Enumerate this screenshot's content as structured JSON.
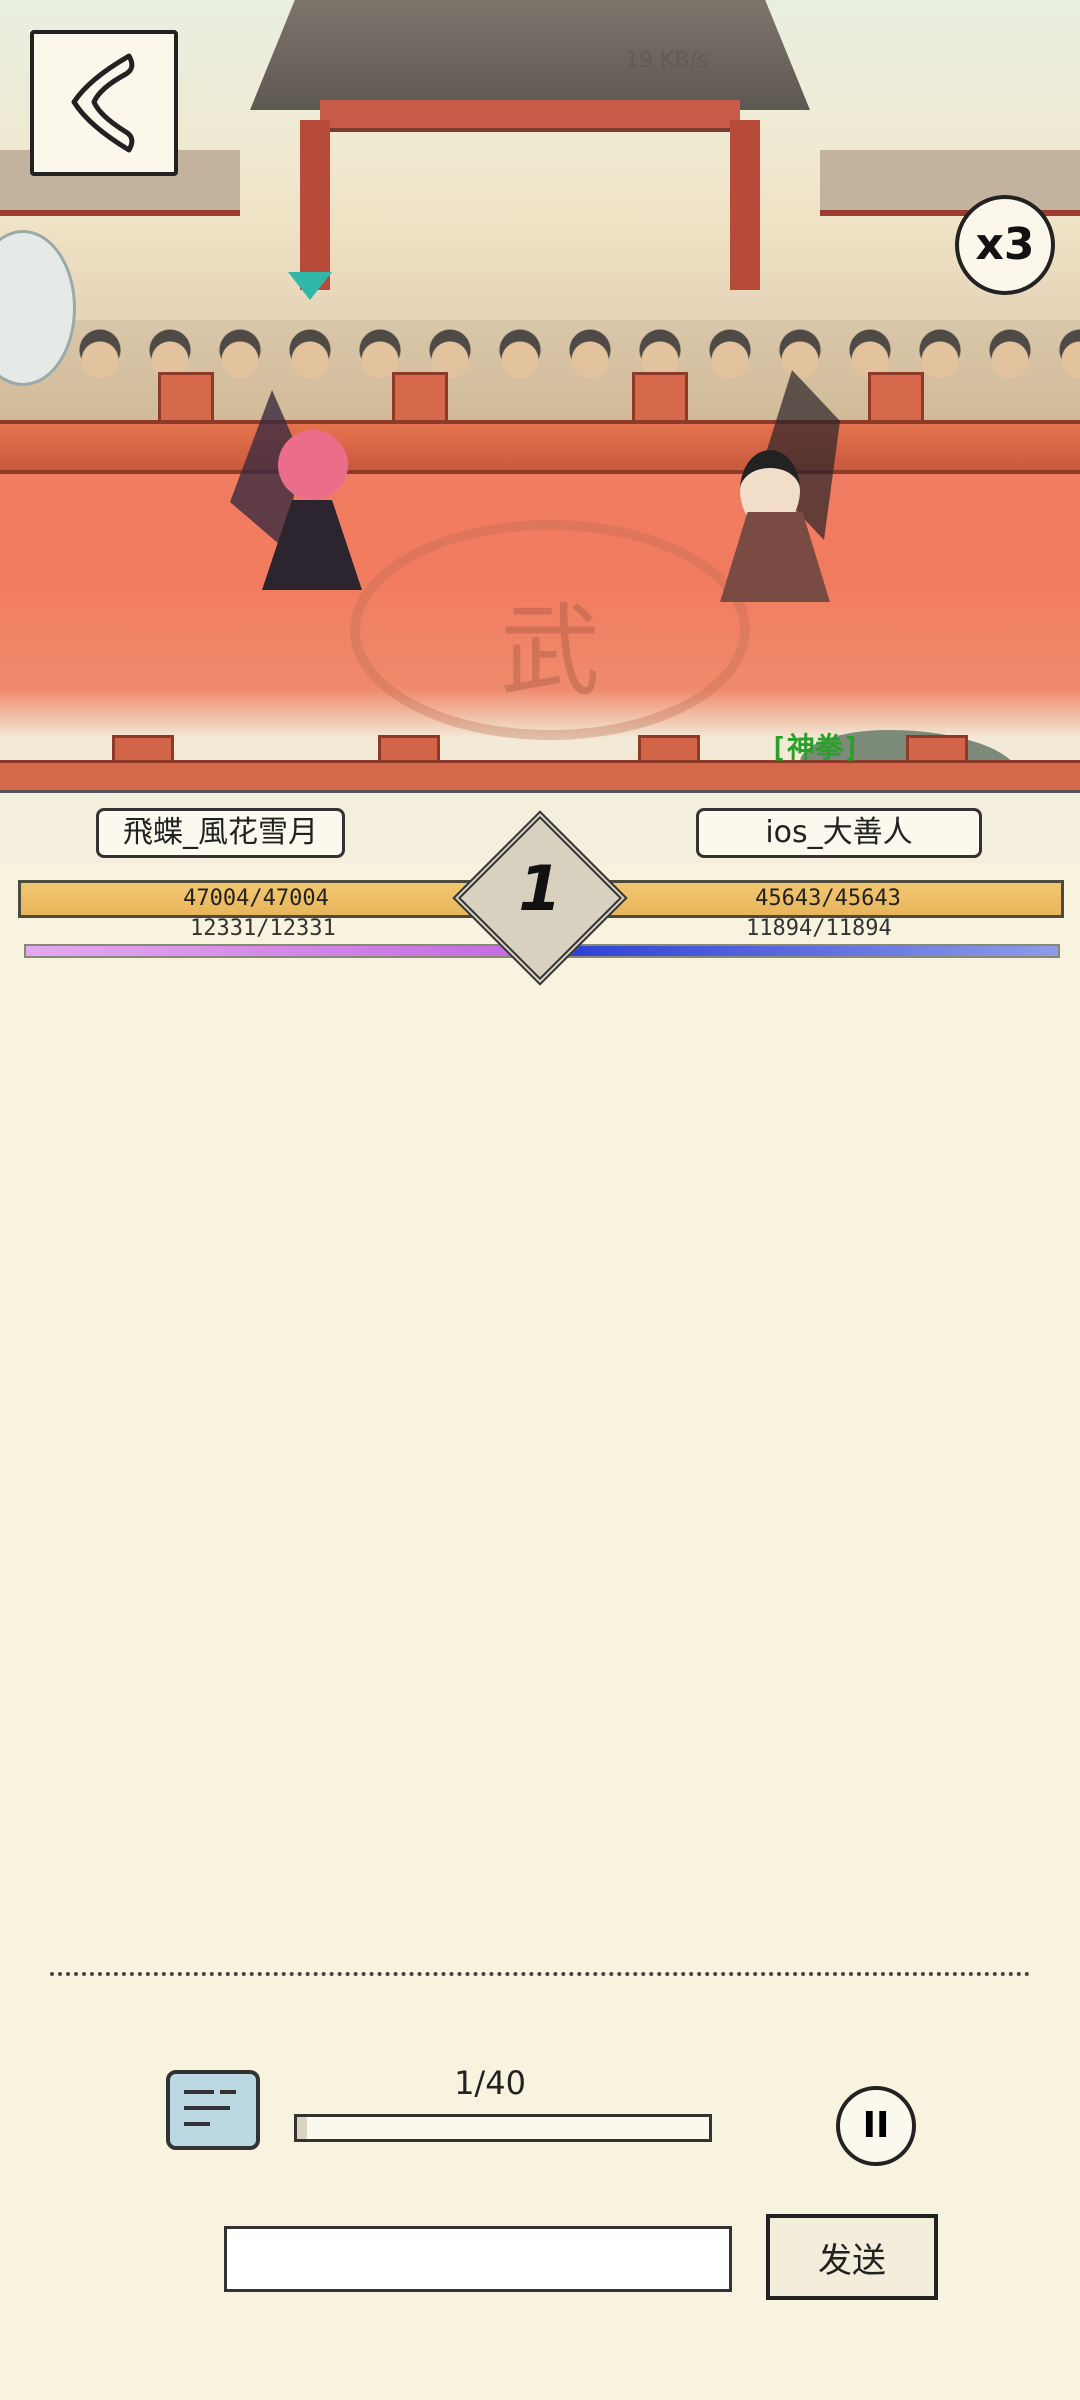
{
  "arena": {
    "speed_label": "x3",
    "emblem_text": "武",
    "status_faded": "19 KB/s",
    "enemy_tag": "[神拳]"
  },
  "players": {
    "left": {
      "name": "飛蝶_風花雪月",
      "hp_text": "47004/47004",
      "hp_fraction": 1.0,
      "mp_text": "12331/12331",
      "mp_fraction": 1.0
    },
    "right": {
      "name": "ios_大善人",
      "hp_text": "45643/45643",
      "hp_fraction": 1.0,
      "mp_text": "11894/11894",
      "mp_fraction": 1.0
    }
  },
  "round": {
    "number": "1"
  },
  "controls": {
    "progress_text": "1/40",
    "progress_fraction": 0.025,
    "pause_label": "II",
    "chat_input_value": "",
    "send_label": "发送"
  },
  "colors": {
    "hp": "#e8b55b",
    "mp_left": "#c36be0",
    "mp_right": "#2c3fd6",
    "floor": "#f07e62"
  },
  "icons": {
    "back": "back-arrow-icon",
    "chat": "chat-bubble-icon",
    "pause": "pause-icon",
    "marker": "turn-indicator-icon"
  }
}
